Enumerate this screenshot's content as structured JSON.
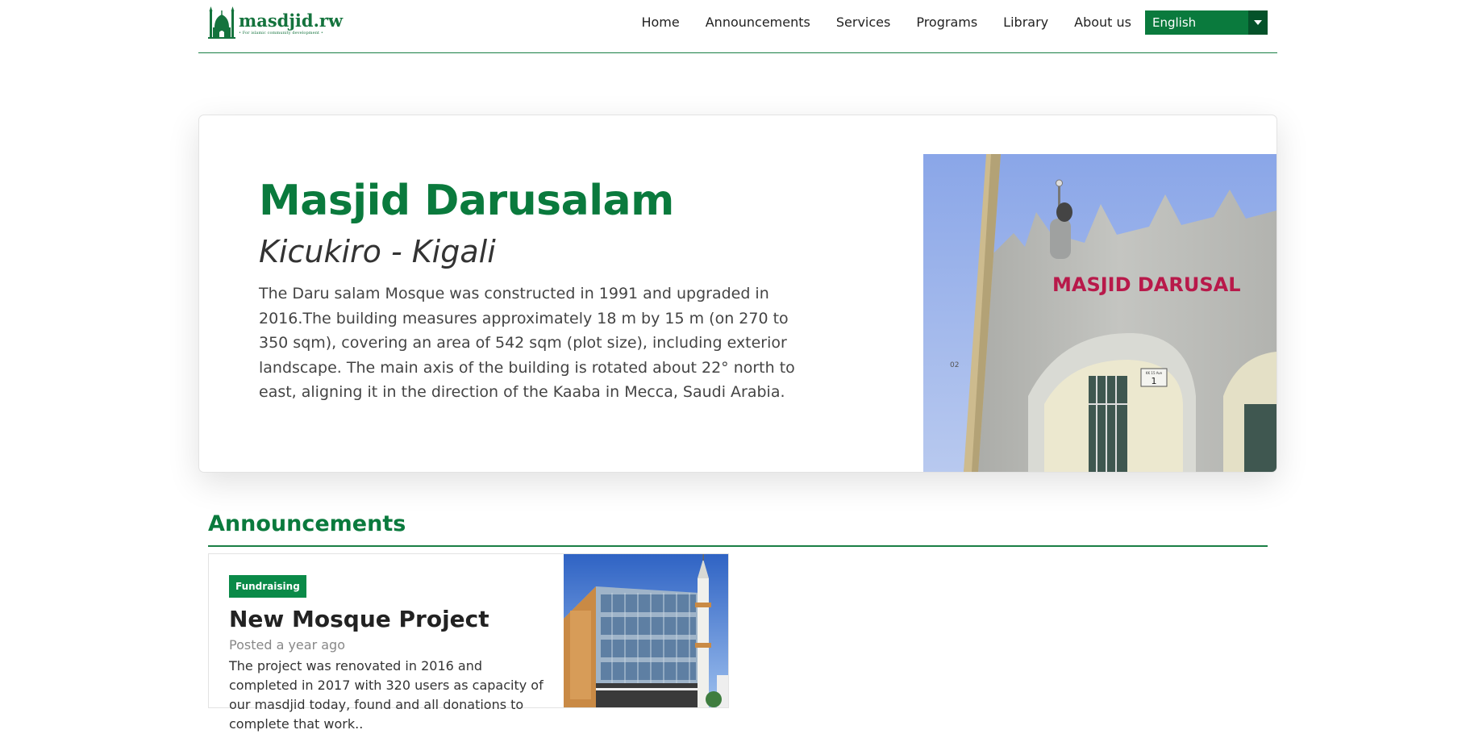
{
  "brand": {
    "name": "masdjid.rw",
    "tagline": "• For islamic community development •"
  },
  "nav": {
    "items": [
      "Home",
      "Announcements",
      "Services",
      "Programs",
      "Library",
      "About us"
    ],
    "language": {
      "selected": "English"
    }
  },
  "hero": {
    "title": "Masjid Darusalam",
    "subtitle": "Kicukiro - Kigali",
    "description": "The Daru salam Mosque was constructed in 1991 and upgraded in 2016.The building measures approximately 18 m by 15 m (on 270 to 350 sqm), covering an area of 542 sqm (plot size), including exterior landscape. The main axis of the building is rotated about 22° north to east, aligning it in the direction of the Kaaba in Mecca, Saudi Arabia.",
    "image": {
      "sign_text": "MASJID DARUSAL",
      "plate_text": "KK 15 Ave",
      "plate_number": "1",
      "wall_number": "02"
    }
  },
  "announcements": {
    "heading": "Announcements",
    "items": [
      {
        "category": "Fundraising",
        "title": "New Mosque Project",
        "posted": "Posted a year ago",
        "summary": "The project was renovated in 2016 and completed in 2017 with 320 users as capacity of our masdjid today, found and all donations to complete that work.."
      }
    ]
  },
  "colors": {
    "brand_green": "#0a7a3d",
    "dark_green": "#05522a",
    "badge_green": "#0a8a48"
  }
}
